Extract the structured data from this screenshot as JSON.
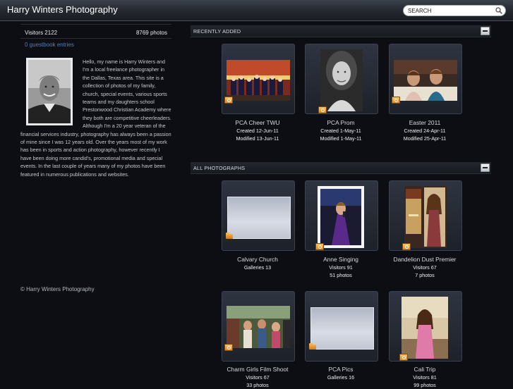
{
  "header": {
    "title": "Harry Winters Photography",
    "search_placeholder": "SEARCH"
  },
  "sidebar": {
    "visitors": "Visitors 2122",
    "photos": "8769 photos",
    "guestbook": "0 guestbook entries",
    "bio": "Hello, my name is Harry Winters and I'm a local freelance photographer in the Dallas, Texas area. This site is a collection of photos of my family, church, special events, various sports teams and my daughters school Prestonwood Christian Academy where they both are competitive cheerleaders. Although I'm a 20 year veteran of the financial services industry, photography has always been a passion of mine since I was 12 years old. Over the years most of my work has been in sports and action photography, however recently I have been doing more candid's, promotional media and special events. In the last couple of years many of my photos have been featured in numerous publications and websites.",
    "footer": "© Harry Winters Photography"
  },
  "recent": {
    "label": "RECENTLY ADDED",
    "items": [
      {
        "title": "PCA Cheer TWU",
        "line1": "Created 12-Jun-11",
        "line2": "Modified 13-Jun-11"
      },
      {
        "title": "PCA Prom",
        "line1": "Created 1-May-11",
        "line2": "Modified 1-May-11"
      },
      {
        "title": "Easter 2011",
        "line1": "Created 24-Apr-11",
        "line2": "Modified 25-Apr-11"
      }
    ]
  },
  "all": {
    "label": "ALL PHOTOGRAPHS",
    "items": [
      {
        "title": "Calvary Church",
        "line1": "Galleries 13",
        "line2": ""
      },
      {
        "title": "Anne Singing",
        "line1": "Visitors 91",
        "line2": "51 photos"
      },
      {
        "title": "Dandelion Dust Premier",
        "line1": "Visitors 67",
        "line2": "7 photos"
      },
      {
        "title": "Charm Girls Film Shoot",
        "line1": "Visitors 67",
        "line2": "33 photos"
      },
      {
        "title": "PCA Pics",
        "line1": "Galleries 16",
        "line2": ""
      },
      {
        "title": "Cali Trip",
        "line1": "Visitors 81",
        "line2": "99 photos"
      }
    ]
  }
}
